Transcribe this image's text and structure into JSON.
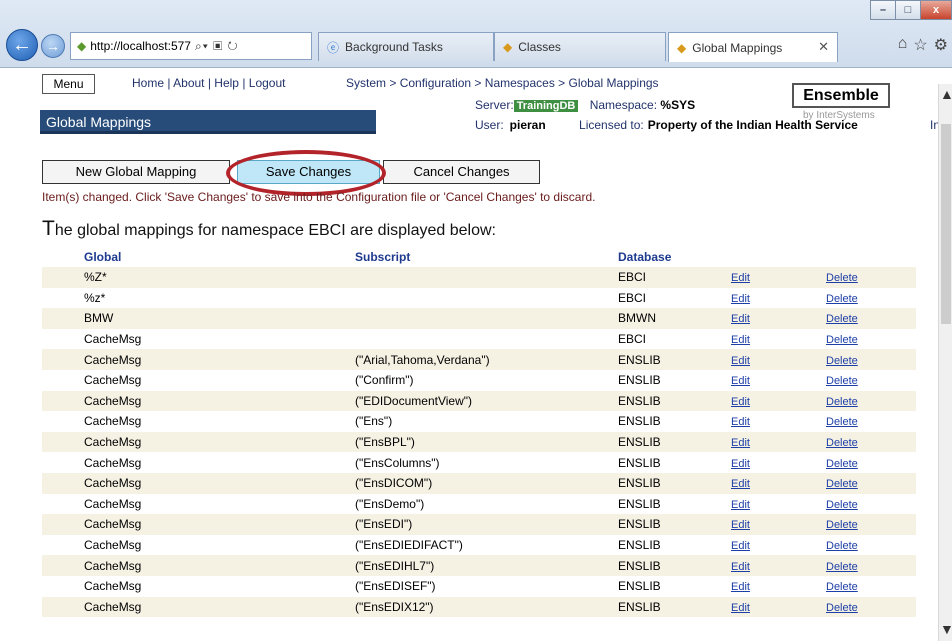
{
  "browser": {
    "address": "http://localhost:577",
    "tabs": [
      {
        "label": "Background Tasks"
      },
      {
        "label": "Classes"
      },
      {
        "label": "Global Mappings"
      }
    ],
    "window_buttons": {
      "minimize": "–",
      "maximize": "□",
      "close": "x"
    }
  },
  "header": {
    "menu_label": "Menu",
    "links": [
      "Home",
      "About",
      "Help",
      "Logout"
    ],
    "breadcrumb": [
      "System",
      "Configuration",
      "Namespaces",
      "Global Mappings"
    ],
    "page_title": "Global Mappings",
    "server_label": "Server:",
    "server_value": "TrainingDB",
    "namespace_label": "Namespace:",
    "namespace_value": "%SYS",
    "user_label": "User:",
    "user_value": "pieran",
    "licensed_label": "Licensed to:",
    "licensed_value": "Property of the Indian Health Service",
    "product": "Ensemble",
    "byline": "by InterSystems",
    "overflow_text": "In"
  },
  "actions": {
    "new_label": "New Global Mapping",
    "save_label": "Save Changes",
    "cancel_label": "Cancel Changes"
  },
  "message": "Item(s) changed. Click 'Save Changes' to save into the Configuration file or 'Cancel Changes' to discard.",
  "intro": {
    "first_letter": "T",
    "rest": "he global mappings for namespace EBCI are displayed below:"
  },
  "table": {
    "headers": {
      "global": "Global",
      "subscript": "Subscript",
      "database": "Database"
    },
    "edit_label": "Edit",
    "delete_label": "Delete",
    "rows": [
      {
        "global": "%Z*",
        "subscript": "",
        "database": "EBCI"
      },
      {
        "global": "%z*",
        "subscript": "",
        "database": "EBCI"
      },
      {
        "global": "BMW",
        "subscript": "",
        "database": "BMWN"
      },
      {
        "global": "CacheMsg",
        "subscript": "",
        "database": "EBCI"
      },
      {
        "global": "CacheMsg",
        "subscript": "(\"Arial,Tahoma,Verdana\")",
        "database": "ENSLIB"
      },
      {
        "global": "CacheMsg",
        "subscript": "(\"Confirm\")",
        "database": "ENSLIB"
      },
      {
        "global": "CacheMsg",
        "subscript": "(\"EDIDocumentView\")",
        "database": "ENSLIB"
      },
      {
        "global": "CacheMsg",
        "subscript": "(\"Ens\")",
        "database": "ENSLIB"
      },
      {
        "global": "CacheMsg",
        "subscript": "(\"EnsBPL\")",
        "database": "ENSLIB"
      },
      {
        "global": "CacheMsg",
        "subscript": "(\"EnsColumns\")",
        "database": "ENSLIB"
      },
      {
        "global": "CacheMsg",
        "subscript": "(\"EnsDICOM\")",
        "database": "ENSLIB"
      },
      {
        "global": "CacheMsg",
        "subscript": "(\"EnsDemo\")",
        "database": "ENSLIB"
      },
      {
        "global": "CacheMsg",
        "subscript": "(\"EnsEDI\")",
        "database": "ENSLIB"
      },
      {
        "global": "CacheMsg",
        "subscript": "(\"EnsEDIEDIFACT\")",
        "database": "ENSLIB"
      },
      {
        "global": "CacheMsg",
        "subscript": "(\"EnsEDIHL7\")",
        "database": "ENSLIB"
      },
      {
        "global": "CacheMsg",
        "subscript": "(\"EnsEDISEF\")",
        "database": "ENSLIB"
      },
      {
        "global": "CacheMsg",
        "subscript": "(\"EnsEDIX12\")",
        "database": "ENSLIB"
      }
    ]
  },
  "colors": {
    "title_bar": "#274c79",
    "server_badge": "#3f8f43",
    "save_button": "#bfe7f8",
    "highlight_ellipse": "#b3242a",
    "table_header_text": "#1e3a8f",
    "row_stripe": "#f5f1e3"
  }
}
